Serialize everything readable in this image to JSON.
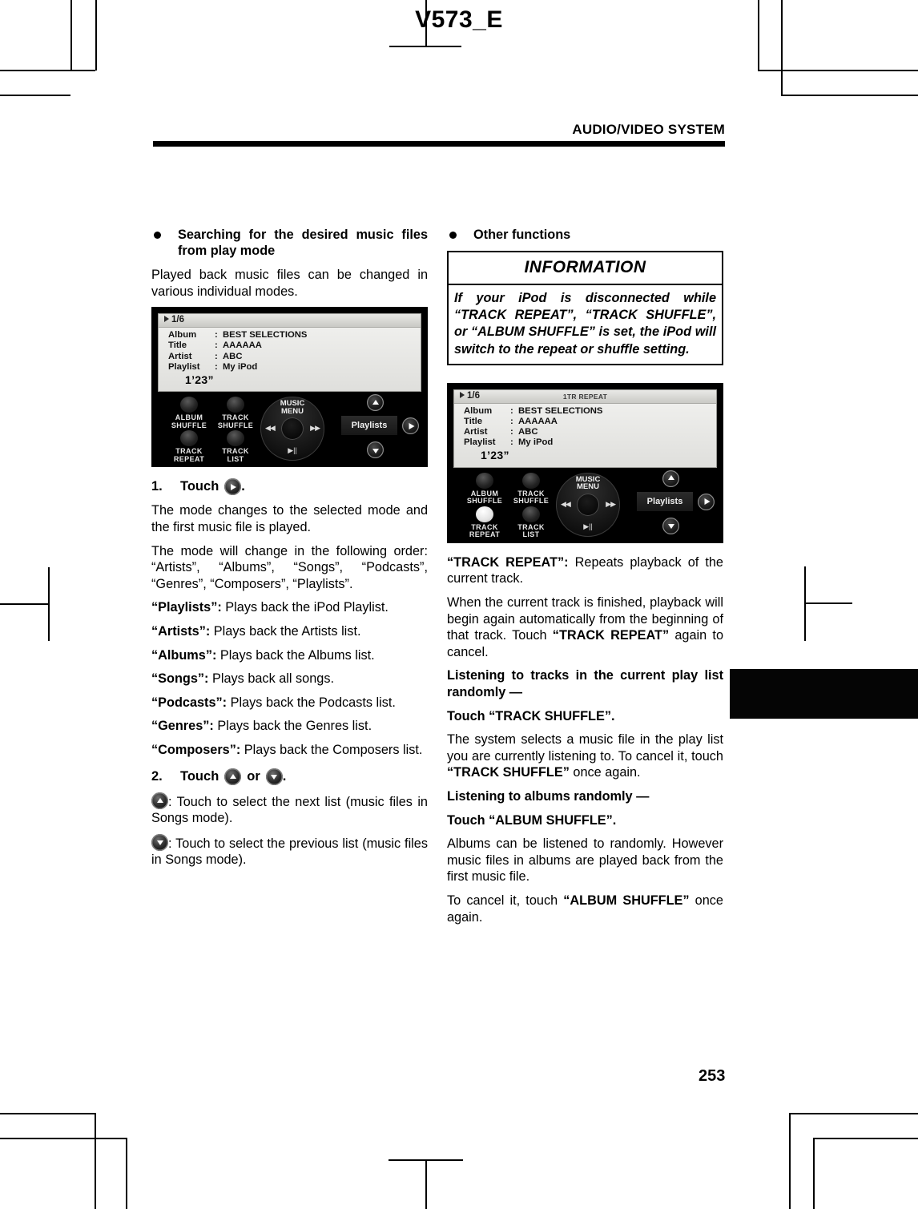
{
  "header": {
    "doc_code": "V573_E",
    "section": "AUDIO/VIDEO SYSTEM"
  },
  "footer": {
    "page_number": "253"
  },
  "left_column": {
    "heading": "Searching for the desired music files from play mode",
    "intro": "Played back music files can be changed in various individual modes.",
    "device_screen": {
      "track_number": "1/6",
      "mode_tag": "",
      "fields": [
        {
          "key": "Album",
          "value": "BEST SELECTIONS"
        },
        {
          "key": "Title",
          "value": "AAAAAA"
        },
        {
          "key": "Artist",
          "value": "ABC"
        },
        {
          "key": "Playlist",
          "value": "My iPod"
        }
      ],
      "elapsed_time": "1’23”",
      "buttons": {
        "album_shuffle": "ALBUM\nSHUFFLE",
        "album_shuffle_l1": "ALBUM",
        "album_shuffle_l2": "SHUFFLE",
        "track_shuffle_l1": "TRACK",
        "track_shuffle_l2": "SHUFFLE",
        "track_repeat_l1": "TRACK",
        "track_repeat_l2": "REPEAT",
        "track_list_l1": "TRACK",
        "track_list_l2": "LIST",
        "music_menu_l1": "MUSIC",
        "music_menu_l2": "MENU",
        "prev_glyph": "◀◀",
        "next_glyph": "▶▶",
        "playpause_glyph": "▶||",
        "playlists": "Playlists"
      },
      "track_repeat_lit": false
    },
    "step1": {
      "num": "1.",
      "label": "Touch",
      "icon": "play-icon",
      "period": "."
    },
    "step1_desc": "The mode changes to the selected mode and the first music file is played.",
    "order_text": "The mode will change in the following order: “Artists”, “Albums”, “Songs”, “Podcasts”, “Genres”, “Composers”, “Playlists”.",
    "mode_defs": [
      {
        "term": "“Playlists”:",
        "desc": " Plays back the iPod Playlist."
      },
      {
        "term": "“Artists”:",
        "desc": " Plays back the Artists list."
      },
      {
        "term": "“Albums”:",
        "desc": " Plays back the Albums list."
      },
      {
        "term": "“Songs”:",
        "desc": " Plays back all songs."
      },
      {
        "term": "“Podcasts”:",
        "desc": " Plays back the Podcasts list."
      },
      {
        "term": "“Genres”:",
        "desc": " Plays back the Genres list."
      },
      {
        "term": "“Composers”:",
        "desc": " Plays back the Composers list."
      }
    ],
    "step2": {
      "num": "2.",
      "label": "Touch",
      "or": "or",
      "period": "."
    },
    "up_desc": ": Touch to select the next list (music files in Songs mode).",
    "down_desc": ": Touch to select the previous list (music files in Songs mode)."
  },
  "right_column": {
    "heading": "Other functions",
    "information": {
      "title": "INFORMATION",
      "body": "If your iPod is disconnected while “TRACK REPEAT”, “TRACK SHUFFLE”, or “ALBUM SHUFFLE” is set, the iPod will switch to the repeat or shuffle setting."
    },
    "device_screen": {
      "track_number": "1/6",
      "mode_tag": "1TR REPEAT",
      "fields": [
        {
          "key": "Album",
          "value": "BEST SELECTIONS"
        },
        {
          "key": "Title",
          "value": "AAAAAA"
        },
        {
          "key": "Artist",
          "value": "ABC"
        },
        {
          "key": "Playlist",
          "value": "My iPod"
        }
      ],
      "elapsed_time": "1’23”",
      "buttons": {
        "album_shuffle_l1": "ALBUM",
        "album_shuffle_l2": "SHUFFLE",
        "track_shuffle_l1": "TRACK",
        "track_shuffle_l2": "SHUFFLE",
        "track_repeat_l1": "TRACK",
        "track_repeat_l2": "REPEAT",
        "track_list_l1": "TRACK",
        "track_list_l2": "LIST",
        "music_menu_l1": "MUSIC",
        "music_menu_l2": "MENU",
        "prev_glyph": "◀◀",
        "next_glyph": "▶▶",
        "playpause_glyph": "▶||",
        "playlists": "Playlists"
      },
      "track_repeat_lit": true
    },
    "track_repeat_def_term": "“TRACK REPEAT”:",
    "track_repeat_def_rest": " Repeats playback of the current track.",
    "track_repeat_body_1": "When the current track is finished, playback will begin again automatically from the beginning of that track. Touch ",
    "track_repeat_body_bold": "“TRACK REPEAT”",
    "track_repeat_body_2": " again to cancel.",
    "shuffle_head_1": "Listening to tracks in the current play list randomly —",
    "shuffle_touch_1": "Touch “TRACK SHUFFLE”.",
    "shuffle_body_1a": "The system selects a music file in the play list you are currently listening to. To cancel it, touch ",
    "shuffle_body_1b": "“TRACK SHUFFLE”",
    "shuffle_body_1c": " once again.",
    "shuffle_head_2": "Listening to albums randomly —",
    "shuffle_touch_2": "Touch “ALBUM SHUFFLE”.",
    "shuffle_body_2": "Albums can be listened to randomly. However music files in albums are played back from the first music file.",
    "shuffle_body_3a": "To cancel it, touch ",
    "shuffle_body_3b": "“ALBUM SHUFFLE”",
    "shuffle_body_3c": " once again."
  }
}
